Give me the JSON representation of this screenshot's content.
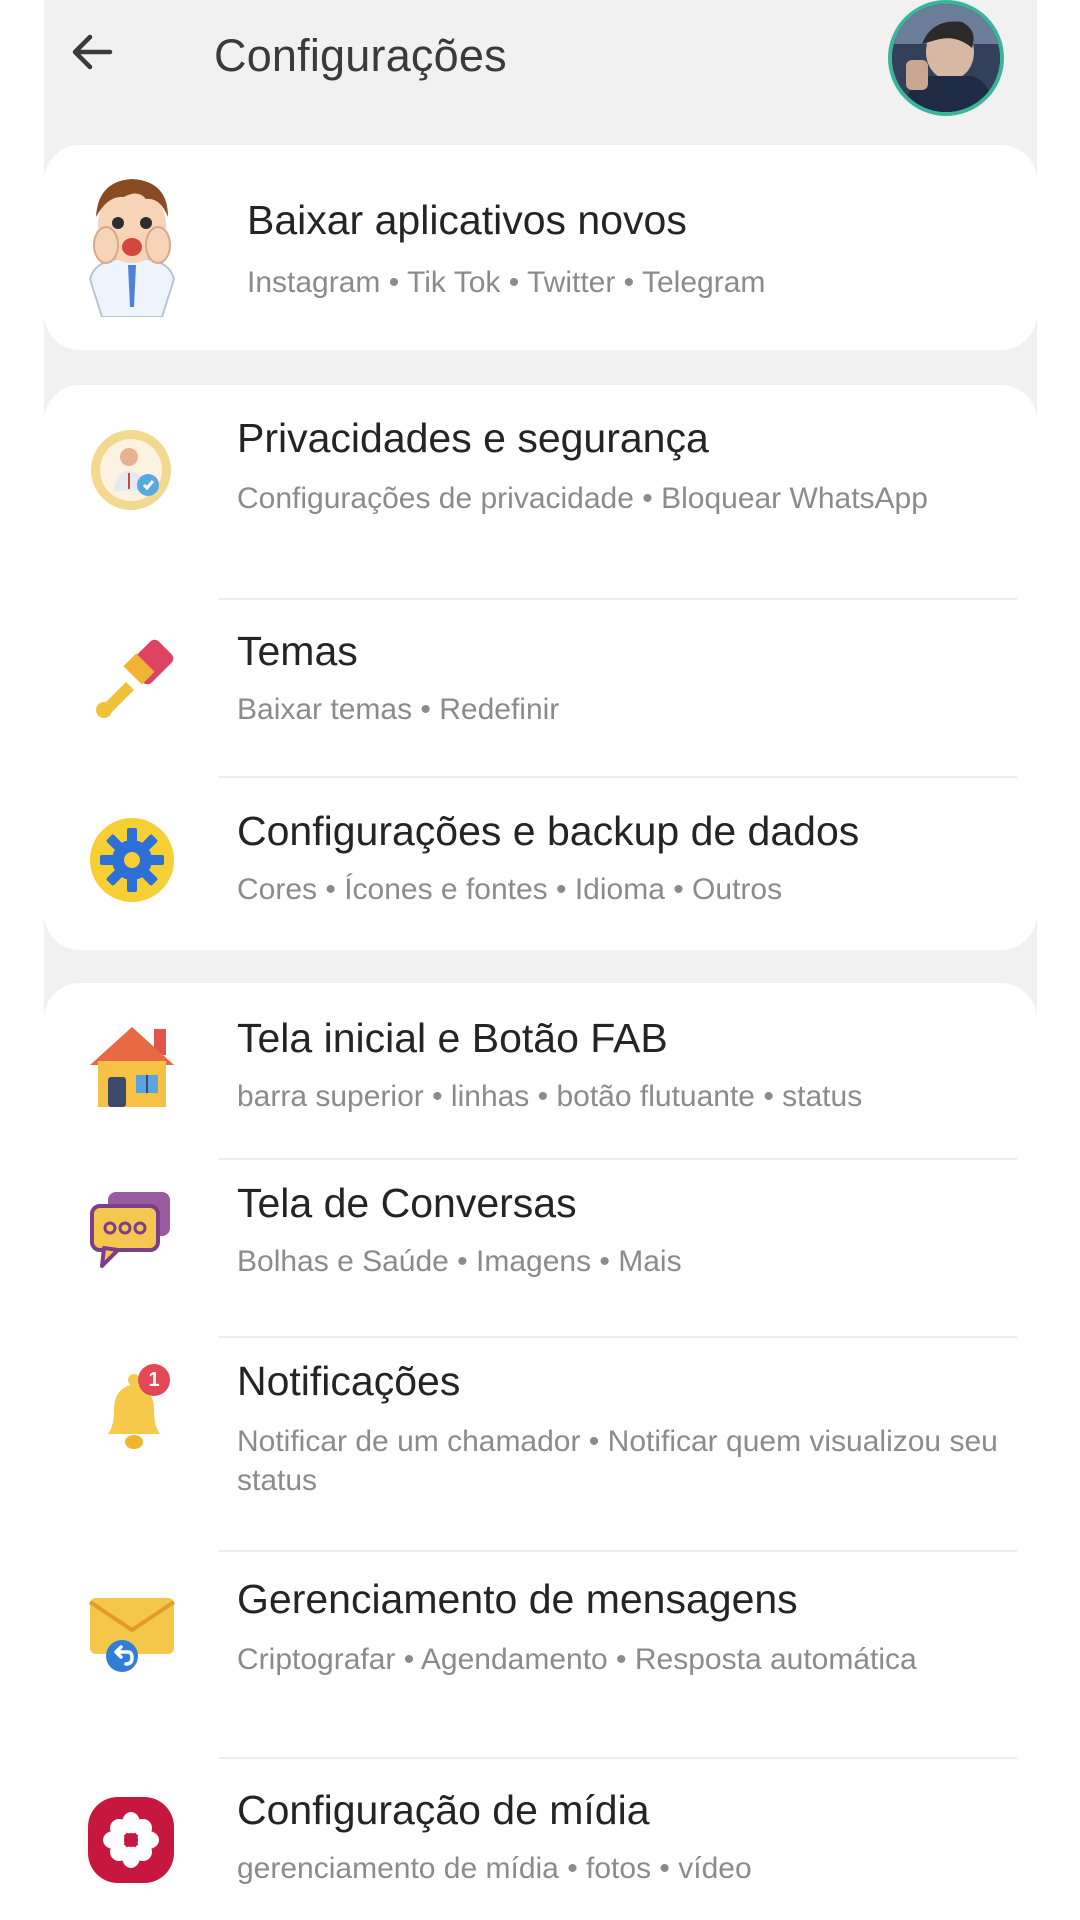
{
  "header": {
    "title": "Configurações"
  },
  "promo": {
    "label": "Baixar aplicativos novos",
    "sub": "Instagram • Tik Tok • Twitter • Telegram"
  },
  "section1": [
    {
      "label": "Privacidades e segurança",
      "sub": "Configurações de privacidade • Bloquear WhatsApp",
      "icon": "privacy-icon"
    },
    {
      "label": "Temas",
      "sub": "Baixar temas • Redefinir",
      "icon": "paintbrush-icon"
    },
    {
      "label": "Configurações e backup de dados",
      "sub": "Cores • Ícones e fontes • Idioma • Outros",
      "icon": "gear-icon"
    }
  ],
  "section2": [
    {
      "label": "Tela inicial e Botão FAB",
      "sub": "barra superior • linhas • botão flutuante • status",
      "icon": "house-icon"
    },
    {
      "label": "Tela de Conversas",
      "sub": "Bolhas e Saúde • Imagens • Mais",
      "icon": "chat-bubbles-icon"
    },
    {
      "label": "Notificações",
      "sub": "Notificar de um chamador • Notificar quem visualizou seu status",
      "icon": "bell-icon",
      "badge": "1"
    },
    {
      "label": "Gerenciamento de mensagens",
      "sub": "Criptografar • Agendamento • Resposta automática",
      "icon": "envelope-icon"
    },
    {
      "label": "Configuração de mídia",
      "sub": "gerenciamento de mídia • fotos • vídeo",
      "icon": "media-flower-icon"
    }
  ],
  "colors": {
    "background": "#f1f1f1",
    "card": "#ffffff",
    "avatar_ring": "#3bb59a",
    "title_text": "#3a3a3a",
    "subtitle_text": "#8b8b8b"
  }
}
